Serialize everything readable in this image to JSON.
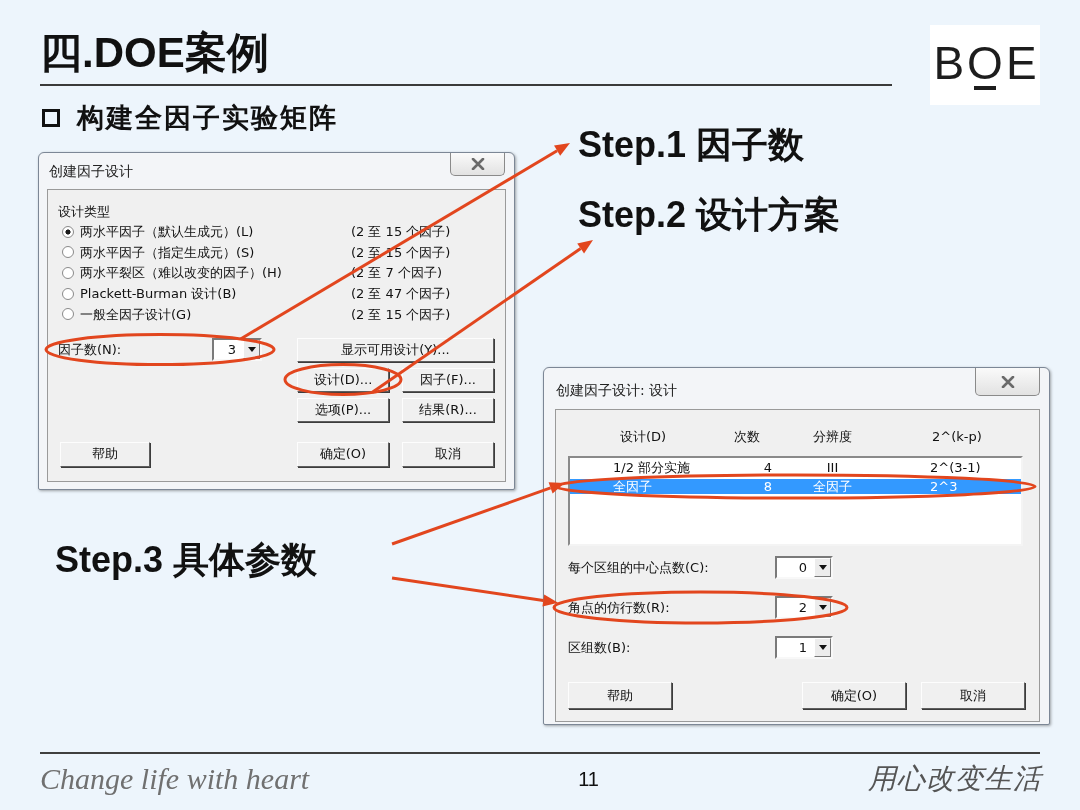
{
  "header": {
    "title": "四.DOE案例",
    "logo": "BOE"
  },
  "bullet": "构建全因子实验矩阵",
  "steps": [
    "Step.1 因子数",
    "Step.2 设计方案",
    "Step.3 具体参数"
  ],
  "dialog_main": {
    "title": "创建因子设计",
    "group_label": "设计类型",
    "design_types": [
      {
        "label": "两水平因子（默认生成元）(L)",
        "range": "(2 至 15 个因子)",
        "selected": true
      },
      {
        "label": "两水平因子（指定生成元）(S)",
        "range": "(2 至 15 个因子)",
        "selected": false
      },
      {
        "label": "两水平裂区（难以改变的因子）(H)",
        "range": "(2 至 7 个因子)",
        "selected": false
      },
      {
        "label": "Plackett-Burman 设计(B)",
        "range": "(2 至 47 个因子)",
        "selected": false
      },
      {
        "label": "一般全因子设计(G)",
        "range": "(2 至 15 个因子)",
        "selected": false
      }
    ],
    "factor_count": {
      "label": "因子数(N):",
      "value": "3",
      "highlighted": true
    },
    "buttons": [
      {
        "label": "显示可用设计(Y)...",
        "highlighted": false
      },
      {
        "label": "设计(D)...",
        "highlighted": true
      },
      {
        "label": "因子(F)...",
        "highlighted": false
      },
      {
        "label": "选项(P)...",
        "highlighted": false
      },
      {
        "label": "结果(R)...",
        "highlighted": false
      }
    ],
    "footer_buttons": [
      "帮助",
      "确定(O)",
      "取消"
    ]
  },
  "dialog_design": {
    "title": "创建因子设计: 设计",
    "columns": [
      "设计(D)",
      "次数",
      "分辨度",
      "2^(k-p)"
    ],
    "rows": [
      {
        "cells": [
          "1/2 部分实施",
          "4",
          "III",
          "2^(3-1)"
        ],
        "selected": false,
        "highlighted": false
      },
      {
        "cells": [
          "全因子",
          "8",
          "全因子",
          "2^3"
        ],
        "selected": true,
        "highlighted": true
      }
    ],
    "fields": [
      {
        "label": "每个区组的中心点数(C):",
        "value": "0",
        "highlighted": false
      },
      {
        "label": "角点的仿行数(R):",
        "value": "2",
        "highlighted": true
      },
      {
        "label": "区组数(B):",
        "value": "1",
        "highlighted": false
      }
    ],
    "buttons": [
      "帮助",
      "确定(O)",
      "取消"
    ]
  },
  "footer": {
    "slogan": "Change life with heart",
    "page": "11",
    "slogan_cn": "用心改变生活"
  }
}
